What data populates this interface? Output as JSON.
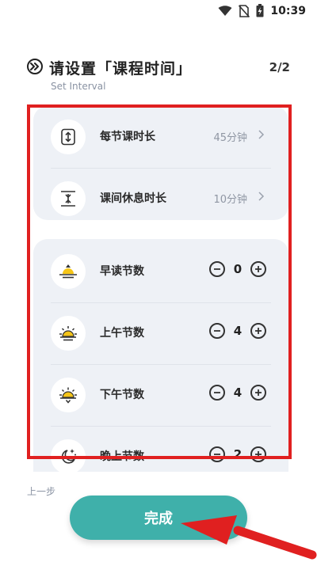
{
  "status_bar": {
    "time": "10:39"
  },
  "header": {
    "title": "请设置「课程时间」",
    "subtitle": "Set Interval",
    "step": "2/2",
    "icon": "double-chevron-right-icon"
  },
  "duration_settings": [
    {
      "label": "每节课时长",
      "value": "45分钟",
      "icon": "expand-vertical-icon"
    },
    {
      "label": "课间休息时长",
      "value": "10分钟",
      "icon": "compress-vertical-icon"
    }
  ],
  "period_counts": [
    {
      "label": "早读节数",
      "count": "0",
      "icon": "sunrise-icon"
    },
    {
      "label": "上午节数",
      "count": "4",
      "icon": "sun-rising-icon"
    },
    {
      "label": "下午节数",
      "count": "4",
      "icon": "sun-setting-icon"
    },
    {
      "label": "晚上节数",
      "count": "2",
      "icon": "moon-stars-icon"
    }
  ],
  "footer": {
    "prev_label": "上一步",
    "finish_label": "完成"
  },
  "colors": {
    "accent": "#3fb0aa",
    "card_bg": "#eef1f6",
    "annotation_red": "#e02020",
    "sun_yellow": "#f5c518"
  }
}
